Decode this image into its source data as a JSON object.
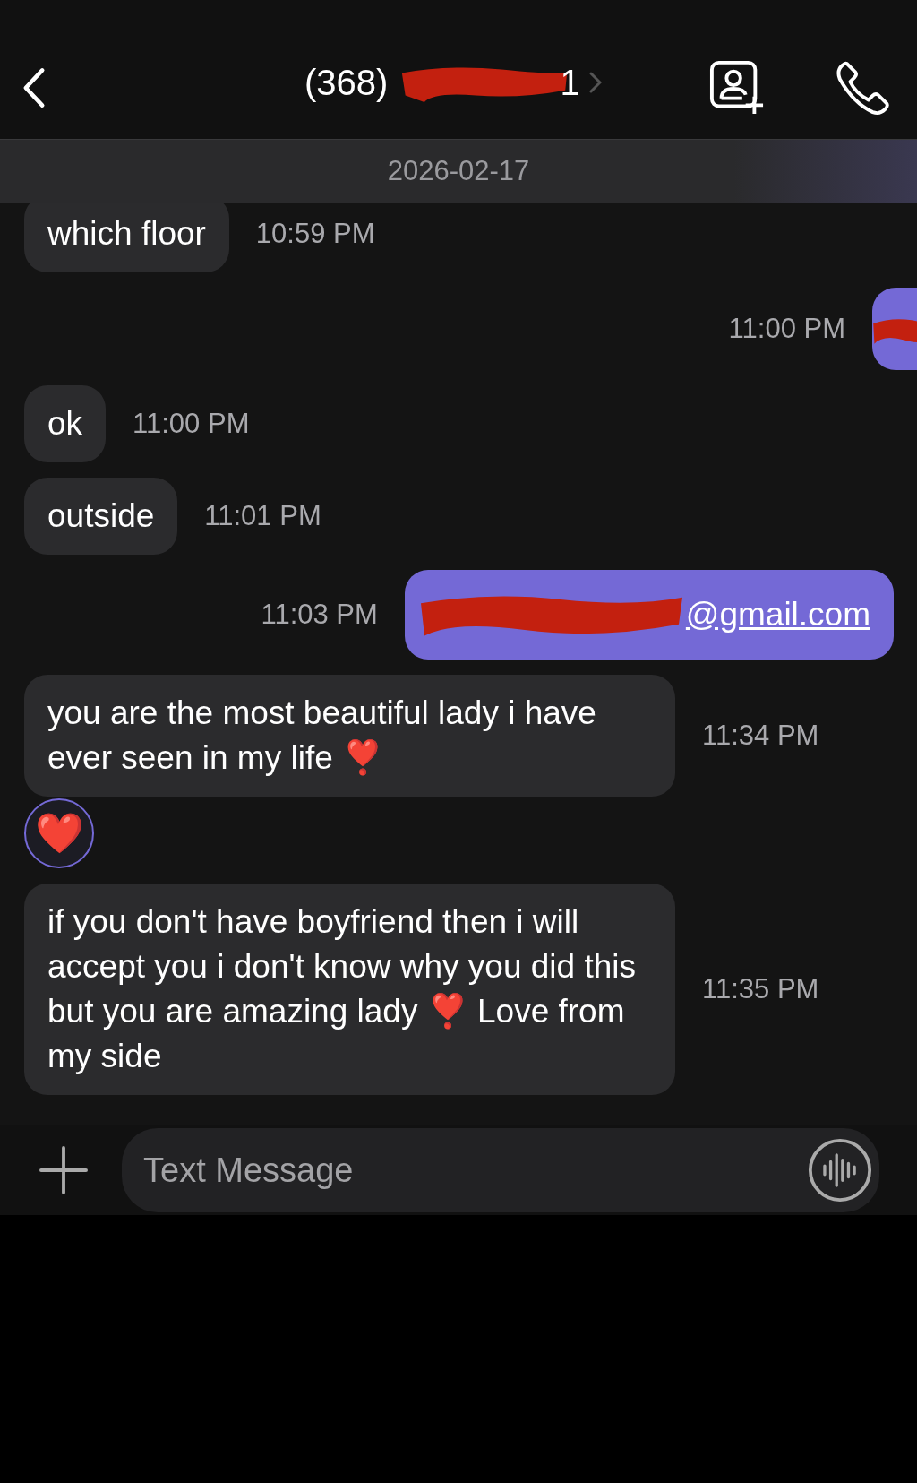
{
  "header": {
    "title": "(368)",
    "redacted": true,
    "title_end": "1"
  },
  "date": "2026-02-17",
  "messages": [
    {
      "kind": "received",
      "text": "which floor",
      "time": "10:59 PM"
    },
    {
      "kind": "sent",
      "time": "11:00 PM",
      "redacted": true
    },
    {
      "kind": "received",
      "text": "ok",
      "time": "11:00 PM"
    },
    {
      "kind": "received",
      "text": "outside",
      "time": "11:01 PM"
    },
    {
      "kind": "sent",
      "text": "@gmail.com",
      "time": "11:03 PM",
      "redacted": true
    },
    {
      "kind": "received",
      "text": "you are the most beautiful lady i have ever seen in my life ❣️",
      "time": "11:34 PM",
      "reaction": "❤️"
    },
    {
      "kind": "received",
      "text": "if you don't have boyfriend then i will accept you i don't know why you did this but you are amazing lady ❣️ Love from my side",
      "time": "11:35 PM"
    }
  ],
  "composer": {
    "placeholder": "Text Message"
  }
}
